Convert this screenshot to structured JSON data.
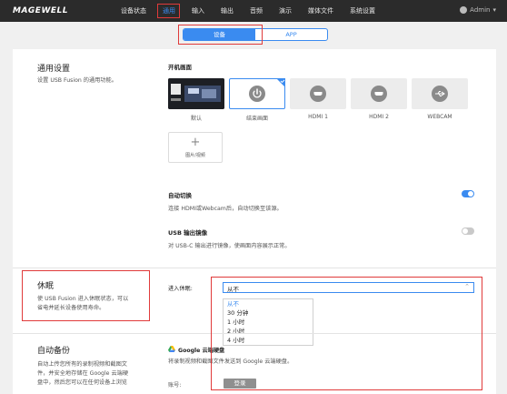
{
  "brand": "MAGEWELL",
  "nav": {
    "items": [
      "设备状态",
      "通用",
      "输入",
      "输出",
      "音频",
      "演示",
      "媒体文件",
      "系统设置"
    ],
    "active_index": 1,
    "admin": "Admin"
  },
  "tabs": {
    "device": "设备",
    "app": "APP"
  },
  "general": {
    "title": "通用设置",
    "desc": "设置 USB Fusion 的通用功能。",
    "boot_label": "开机画面",
    "tiles": [
      "默认",
      "结束画面",
      "HDMI 1",
      "HDMI 2",
      "WEBCAM"
    ],
    "add_tile": "图片/视频"
  },
  "auto_switch": {
    "label": "自动切换",
    "desc": "连接 HDMI或Webcam后，自动切换至该源。",
    "enabled": true
  },
  "usb_mirror": {
    "label": "USB 输出镜像",
    "desc": "对 USB-C 输出进行镜像，使画面内容展示正常。",
    "enabled": false
  },
  "sleep": {
    "title": "休眠",
    "desc_line1": "使 USB Fusion 进入休眠状态，可以",
    "desc_line2": "省电并延长设备使用寿命。",
    "field_label": "进入休眠:",
    "selected": "从不",
    "options": [
      "从不",
      "30 分钟",
      "1 小时",
      "2 小时",
      "4 小时"
    ]
  },
  "backup": {
    "title": "自动备份",
    "desc_line1": "自动上传您所有的录制视频和截图文",
    "desc_line2": "件，并安全地存储在 Google 云端硬",
    "desc_line3": "盘中，然后您可以在任何设备上浏览",
    "gdrive_label": "Google 云端硬盘",
    "gdrive_desc": "将录制视频和截图文件发送到 Google 云端硬盘。",
    "account_label": "账号:",
    "login_button": "登录"
  }
}
